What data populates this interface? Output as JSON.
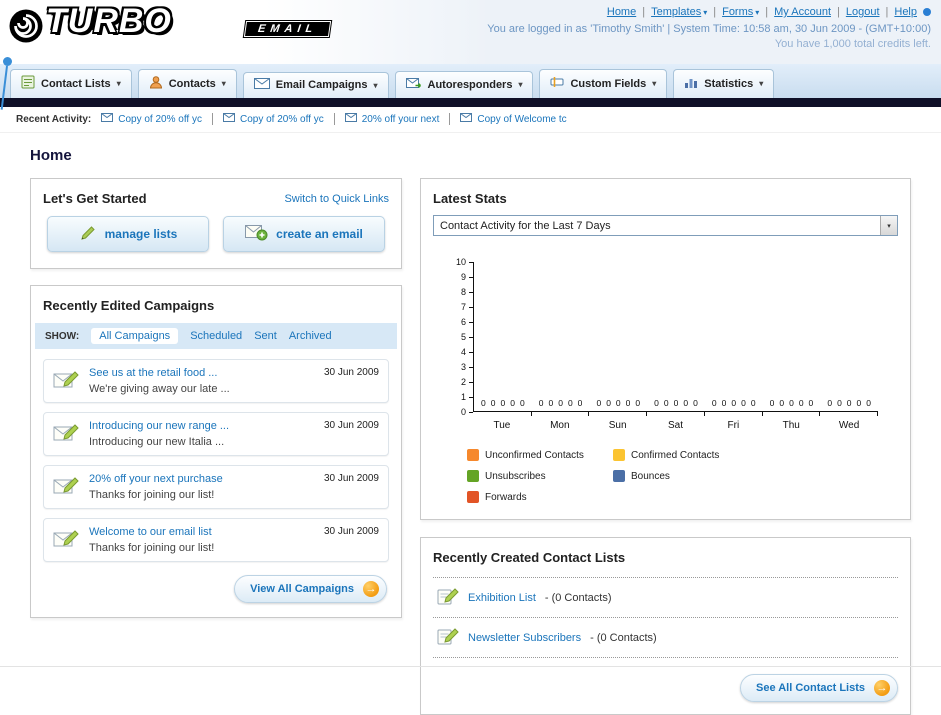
{
  "icons": {
    "chevron_down": "▾",
    "arrow_right": "→",
    "separator": "|"
  },
  "header": {
    "logo_line1": "TURBO",
    "logo_line2": "EMAIL",
    "nav": {
      "home": "Home",
      "templates": "Templates",
      "forms": "Forms",
      "my_account": "My Account",
      "logout": "Logout",
      "help": "Help",
      "separator": "|"
    },
    "login_info": "You are logged in as 'Timothy Smith' | System Time: 10:58 am, 30 Jun 2009 - (GMT+10:00)",
    "credits": "You have 1,000 total credits left."
  },
  "tabs": [
    {
      "label": "Contact Lists"
    },
    {
      "label": "Contacts"
    },
    {
      "label": "Email Campaigns"
    },
    {
      "label": "Autoresponders"
    },
    {
      "label": "Custom Fields"
    },
    {
      "label": "Statistics"
    }
  ],
  "recent_activity": {
    "label": "Recent Activity:",
    "items": [
      {
        "text": "Copy of 20% off yc"
      },
      {
        "text": "Copy of 20% off yc"
      },
      {
        "text": "20% off your next"
      },
      {
        "text": "Copy of Welcome tc"
      }
    ]
  },
  "page_title": "Home",
  "get_started": {
    "title": "Let's Get Started",
    "switch_link": "Switch to Quick Links",
    "manage_lists_label": "manage lists",
    "create_email_label": "create an email"
  },
  "campaigns": {
    "title": "Recently Edited Campaigns",
    "show_label": "SHOW:",
    "filters": [
      {
        "label": "All Campaigns"
      },
      {
        "label": "Scheduled"
      },
      {
        "label": "Sent"
      },
      {
        "label": "Archived"
      }
    ],
    "items": [
      {
        "title": "See us at the retail food ...",
        "subtitle": "We're giving away our late ...",
        "date": "30 Jun 2009"
      },
      {
        "title": "Introducing our new range ...",
        "subtitle": "Introducing our new Italia ...",
        "date": "30 Jun 2009"
      },
      {
        "title": "20% off your next purchase",
        "subtitle": "Thanks for joining our list!",
        "date": "30 Jun 2009"
      },
      {
        "title": "Welcome to our email list",
        "subtitle": "Thanks for joining our list!",
        "date": "30 Jun 2009"
      }
    ],
    "view_all_label": "View All Campaigns"
  },
  "stats": {
    "title": "Latest Stats",
    "selected_option": "Contact Activity for the Last 7 Days"
  },
  "chart_data": {
    "type": "bar",
    "title": "Contact Activity for the Last 7 Days",
    "categories": [
      "Tue",
      "Mon",
      "Sun",
      "Sat",
      "Fri",
      "Thu",
      "Wed"
    ],
    "series": [
      {
        "name": "Unconfirmed Contacts",
        "color": "#f6882c",
        "values": [
          0,
          0,
          0,
          0,
          0,
          0,
          0
        ]
      },
      {
        "name": "Confirmed Contacts",
        "color": "#fbc431",
        "values": [
          0,
          0,
          0,
          0,
          0,
          0,
          0
        ]
      },
      {
        "name": "Unsubscribes",
        "color": "#64a425",
        "values": [
          0,
          0,
          0,
          0,
          0,
          0,
          0
        ]
      },
      {
        "name": "Bounces",
        "color": "#4b6fa6",
        "values": [
          0,
          0,
          0,
          0,
          0,
          0,
          0
        ]
      },
      {
        "name": "Forwards",
        "color": "#e25426",
        "values": [
          0,
          0,
          0,
          0,
          0,
          0,
          0
        ]
      }
    ],
    "ylim": [
      0,
      10
    ],
    "xlabel": "",
    "ylabel": "",
    "grid": false,
    "legend_position": "bottom"
  },
  "contact_lists": {
    "title": "Recently Created Contact Lists",
    "items": [
      {
        "name": "Exhibition List",
        "suffix": " - (0 Contacts)"
      },
      {
        "name": "Newsletter Subscribers",
        "suffix": " - (0 Contacts)"
      }
    ],
    "see_all_label": "See All Contact Lists"
  }
}
